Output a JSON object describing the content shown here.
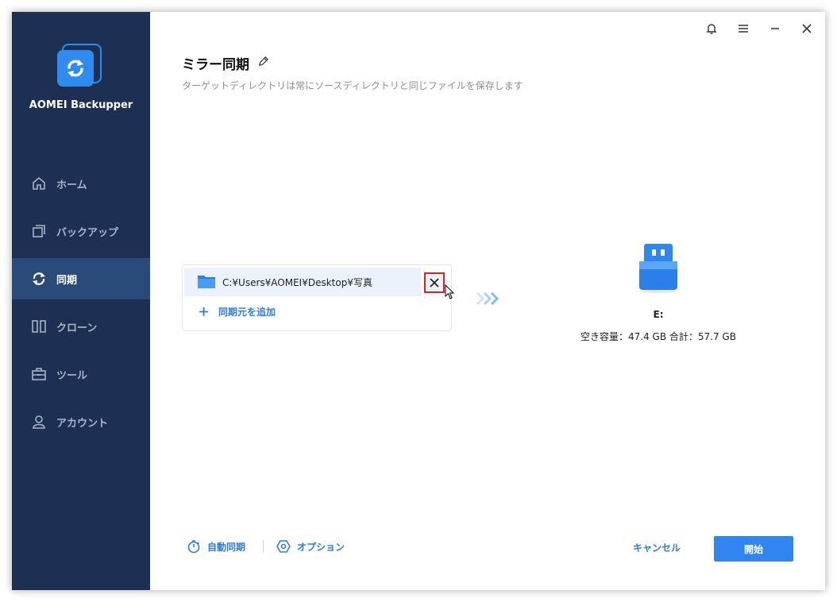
{
  "app": {
    "name": "AOMEI Backupper"
  },
  "nav": {
    "items": [
      {
        "label": "ホーム",
        "icon": "home-icon",
        "active": false
      },
      {
        "label": "バックアップ",
        "icon": "backup-icon",
        "active": false
      },
      {
        "label": "同期",
        "icon": "sync-icon",
        "active": true
      },
      {
        "label": "クローン",
        "icon": "clone-icon",
        "active": false
      },
      {
        "label": "ツール",
        "icon": "tools-icon",
        "active": false
      },
      {
        "label": "アカウント",
        "icon": "user-icon",
        "active": false
      }
    ]
  },
  "header": {
    "title": "ミラー同期",
    "subtitle": "ターゲットディレクトリは常にソースディレクトリと同じファイルを保存します"
  },
  "source": {
    "path": "C:¥Users¥AOMEI¥Desktop¥写真",
    "add_label": "同期元を追加"
  },
  "destination": {
    "drive": "E:",
    "capacity": "空き容量：47.4 GB 合計：57.7 GB"
  },
  "footer": {
    "auto_sync": "自動同期",
    "options": "オプション",
    "cancel": "キャンセル",
    "start": "開始"
  },
  "colors": {
    "sidebar": "#1d2f52",
    "sidebar_active": "#2a4a7a",
    "accent": "#2f86f0",
    "highlight_border": "#e02020"
  }
}
